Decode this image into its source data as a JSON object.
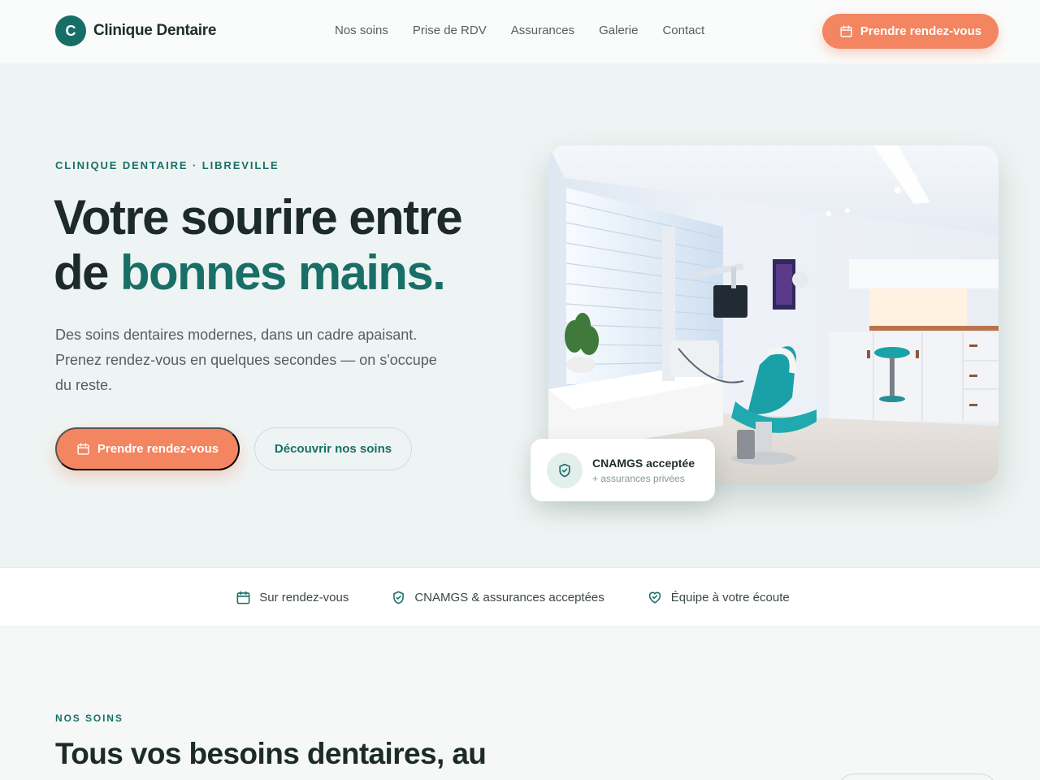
{
  "nav": {
    "logo_letter": "C",
    "brand": "Clinique Dentaire",
    "links": [
      "Nos soins",
      "Prise de RDV",
      "Assurances",
      "Galerie",
      "Contact"
    ],
    "cta": "Prendre rendez-vous"
  },
  "hero": {
    "eyebrow": "CLINIQUE DENTAIRE · LIBREVILLE",
    "title_line1": "Votre sourire entre",
    "title_line2_prefix": "de ",
    "title_accent": "bonnes mains.",
    "description": "Des soins dentaires modernes, dans un cadre apaisant. Prenez rendez-vous en quelques secondes — on s'occupe du reste.",
    "primary_button": "Prendre rendez-vous",
    "secondary_button": "Découvrir nos soins",
    "badge": {
      "title": "CNAMGS acceptée",
      "subtitle": "+ assurances privées"
    }
  },
  "strip": {
    "items": [
      {
        "icon": "calendar-icon",
        "label": "Sur rendez-vous"
      },
      {
        "icon": "shield-check-icon",
        "label": "CNAMGS & assurances acceptées"
      },
      {
        "icon": "heart-handshake-icon",
        "label": "Équipe à votre écoute"
      }
    ]
  },
  "services": {
    "eyebrow": "NOS SOINS",
    "title": "Tous vos besoins dentaires, au"
  },
  "colors": {
    "primary": "#196f67",
    "accent": "#f38560",
    "hero_bg": "#eef4f3"
  }
}
